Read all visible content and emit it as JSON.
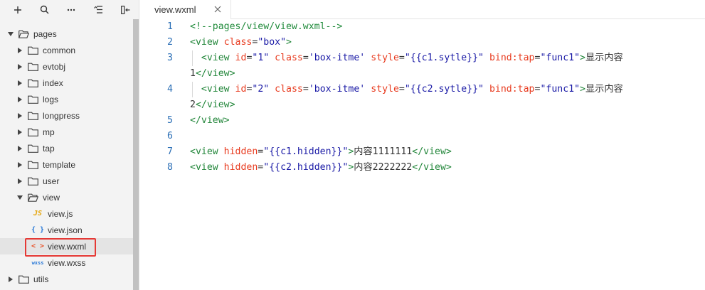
{
  "toolbar": {
    "icons": [
      "plus-icon",
      "search-icon",
      "more-icon",
      "collapse-list-icon",
      "pin-left-icon"
    ]
  },
  "tree": [
    {
      "label": "pages",
      "kind": "folder",
      "open": true,
      "level": 0
    },
    {
      "label": "common",
      "kind": "folder",
      "open": false,
      "level": 1
    },
    {
      "label": "evtobj",
      "kind": "folder",
      "open": false,
      "level": 1
    },
    {
      "label": "index",
      "kind": "folder",
      "open": false,
      "level": 1
    },
    {
      "label": "logs",
      "kind": "folder",
      "open": false,
      "level": 1
    },
    {
      "label": "longpress",
      "kind": "folder",
      "open": false,
      "level": 1
    },
    {
      "label": "mp",
      "kind": "folder",
      "open": false,
      "level": 1
    },
    {
      "label": "tap",
      "kind": "folder",
      "open": false,
      "level": 1
    },
    {
      "label": "template",
      "kind": "folder",
      "open": false,
      "level": 1
    },
    {
      "label": "user",
      "kind": "folder",
      "open": false,
      "level": 1
    },
    {
      "label": "view",
      "kind": "folder",
      "open": true,
      "level": 1
    },
    {
      "label": "view.js",
      "kind": "js",
      "badge": "JS",
      "level": 2
    },
    {
      "label": "view.json",
      "kind": "json",
      "badge": "{ }",
      "level": 2
    },
    {
      "label": "view.wxml",
      "kind": "wxml",
      "badge": "< >",
      "level": 2,
      "selected": true
    },
    {
      "label": "view.wxss",
      "kind": "wxss",
      "badge": "wxss",
      "level": 2
    },
    {
      "label": "utils",
      "kind": "folder",
      "open": false,
      "level": 0
    }
  ],
  "tab": {
    "label": "view.wxml"
  },
  "code": [
    {
      "n": "1",
      "text": "<!--pages/view/view.wxml-->"
    },
    {
      "n": "2",
      "text": "<view class=\"box\">"
    },
    {
      "n": "3",
      "text": "  <view id=\"1\" class='box-itme' style=\"{{c1.sytle}}\" bind:tap=\"func1\">显示内容"
    },
    {
      "n": "",
      "text": "1</view>"
    },
    {
      "n": "4",
      "text": "  <view id=\"2\" class='box-itme' style=\"{{c2.sytle}}\" bind:tap=\"func1\">显示内容"
    },
    {
      "n": "",
      "text": "2</view>"
    },
    {
      "n": "5",
      "text": "</view>"
    },
    {
      "n": "6",
      "text": ""
    },
    {
      "n": "7",
      "text": "<view hidden=\"{{c1.hidden}}\">内容1111111</view>"
    },
    {
      "n": "8",
      "text": "<view hidden=\"{{c2.hidden}}\">内容2222222</view>"
    }
  ],
  "colors": {
    "tag": "#22863a",
    "attr": "#e83b1f",
    "string": "#1a1aa6",
    "comment": "#1f8a3a",
    "line_number": "#2b6fb6",
    "selection_outline": "#e53935"
  }
}
